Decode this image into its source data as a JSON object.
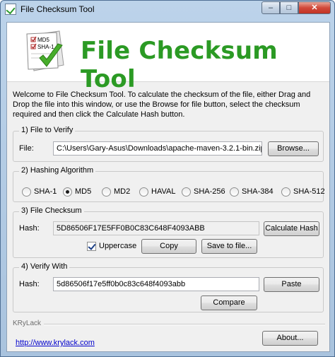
{
  "window": {
    "title": "File Checksum Tool"
  },
  "titlebar_buttons": {
    "minimize": "–",
    "maximize": "□",
    "close": "✕"
  },
  "banner": {
    "title": "File Checksum Tool",
    "logo": {
      "line1": "MD5",
      "line2": "SHA-1",
      "icon": "checklist-document-icon"
    }
  },
  "intro": "Welcome to File Checksum Tool. To calculate the checksum of the file, either Drag and Drop the file into this window, or use the Browse for file button, select the checksum required and then click the Calculate Hash button.",
  "file_to_verify": {
    "legend": "1) File to Verify",
    "label": "File:",
    "value": "C:\\Users\\Gary-Asus\\Downloads\\apache-maven-3.2.1-bin.zip",
    "browse_label": "Browse..."
  },
  "hashing_algorithm": {
    "legend": "2) Hashing Algorithm",
    "options": [
      "SHA-1",
      "MD5",
      "MD2",
      "HAVAL",
      "SHA-256",
      "SHA-384",
      "SHA-512"
    ],
    "selected": "MD5"
  },
  "file_checksum": {
    "legend": "3) File Checksum",
    "label": "Hash:",
    "value": "5D86506F17E5FF0B0C83C648F4093ABB",
    "calculate_label": "Calculate Hash",
    "uppercase_label": "Uppercase",
    "uppercase_checked": true,
    "copy_label": "Copy",
    "save_label": "Save to file..."
  },
  "verify_with": {
    "legend": "4) Verify With",
    "label": "Hash:",
    "value": "5d86506f17e5ff0b0c83c648f4093abb",
    "paste_label": "Paste",
    "compare_label": "Compare"
  },
  "footer": {
    "brand": "KRyLack",
    "link": "http://www.krylack.com",
    "about_label": "About..."
  }
}
